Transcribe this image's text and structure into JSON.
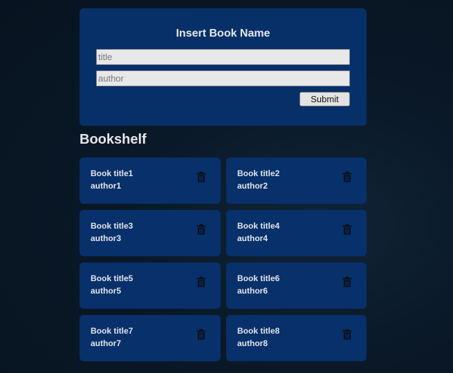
{
  "form": {
    "heading": "Insert Book Name",
    "title_placeholder": "title",
    "author_placeholder": "author",
    "submit_label": "Submit"
  },
  "bookshelf": {
    "heading": "Bookshelf",
    "books": [
      {
        "title": "Book title1",
        "author": "author1"
      },
      {
        "title": "Book title2",
        "author": "author2"
      },
      {
        "title": "Book title3",
        "author": "author3"
      },
      {
        "title": "Book title4",
        "author": "author4"
      },
      {
        "title": "Book title5",
        "author": "author5"
      },
      {
        "title": "Book title6",
        "author": "author6"
      },
      {
        "title": "Book title7",
        "author": "author7"
      },
      {
        "title": "Book title8",
        "author": "author8"
      }
    ],
    "delete_icon": "trash-icon"
  },
  "colors": {
    "page_background": "#0b1a2b",
    "card_background": "#08306a",
    "text": "#e3e6ec",
    "icon": "#0a0f18"
  }
}
